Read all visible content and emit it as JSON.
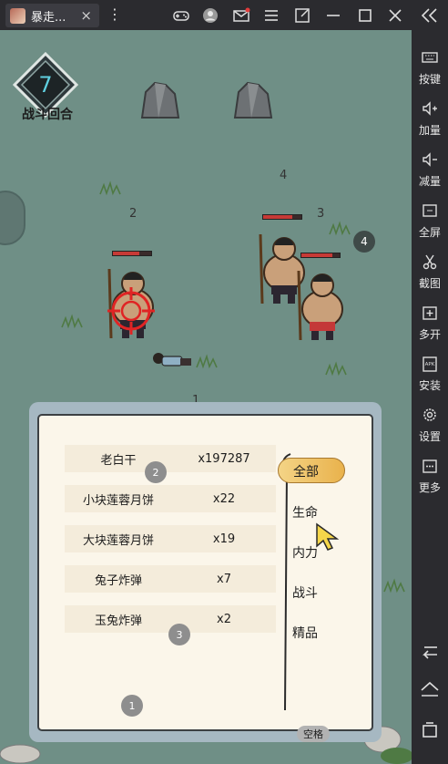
{
  "window": {
    "tab_title": "暴走...",
    "tab_close": "×",
    "menu": "⋮"
  },
  "sidebar": {
    "items": [
      {
        "label": "按键",
        "icon": "keyboard-icon"
      },
      {
        "label": "加量",
        "icon": "volume-up-icon"
      },
      {
        "label": "减量",
        "icon": "volume-down-icon"
      },
      {
        "label": "全屏",
        "icon": "fullscreen-icon"
      },
      {
        "label": "截图",
        "icon": "scissors-icon"
      },
      {
        "label": "多开",
        "icon": "multi-instance-icon"
      },
      {
        "label": "安装",
        "icon": "apk-install-icon"
      },
      {
        "label": "设置",
        "icon": "gear-icon"
      },
      {
        "label": "更多",
        "icon": "more-icon"
      }
    ]
  },
  "game": {
    "round_number": "7",
    "round_label": "战斗回合",
    "floor_labels": {
      "enemy_a": "2",
      "enemy_b": "3",
      "top": "4",
      "player": "1"
    },
    "badges": {
      "enemy_group": "4",
      "item_a": "2",
      "item_b": "3",
      "bottom": "1"
    },
    "enemy_hp": [
      0.7,
      0.75,
      0.8
    ]
  },
  "inventory": {
    "items": [
      {
        "name": "老白干",
        "qty": "x197287"
      },
      {
        "name": "小块莲蓉月饼",
        "qty": "x22"
      },
      {
        "name": "大块莲蓉月饼",
        "qty": "x19"
      },
      {
        "name": "兔子炸弹",
        "qty": "x7"
      },
      {
        "name": "玉兔炸弹",
        "qty": "x2"
      }
    ],
    "categories": [
      "全部",
      "生命",
      "内力",
      "战斗",
      "精品"
    ],
    "active_category": "全部",
    "space_button": "空格"
  }
}
